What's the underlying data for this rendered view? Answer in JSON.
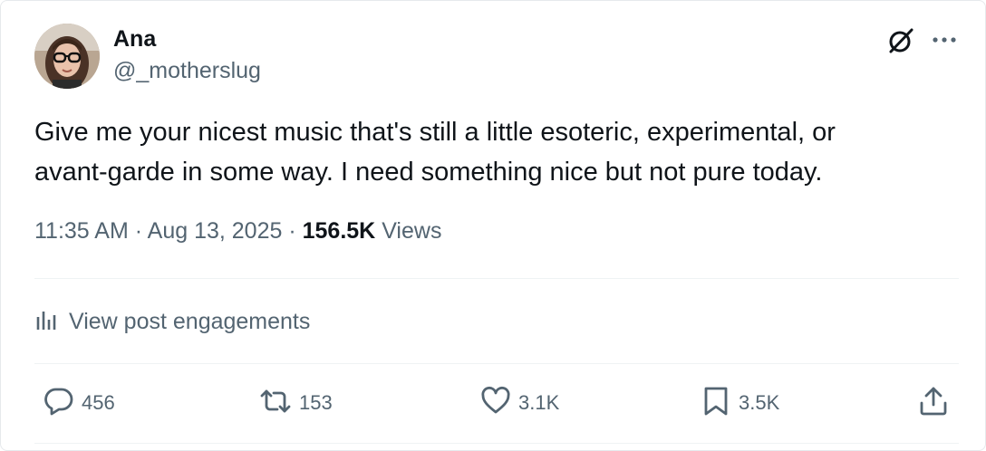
{
  "author": {
    "display_name": "Ana",
    "handle": "@_motherslug"
  },
  "icons": {
    "grok": "grok-icon",
    "more": "more-icon",
    "engagements": "analytics-icon",
    "reply": "reply-icon",
    "repost": "repost-icon",
    "like": "heart-icon",
    "bookmark": "bookmark-icon",
    "share": "share-icon"
  },
  "post": {
    "text": "Give me your nicest music that's still a little esoteric, experimental, or\navant-garde in some way. I need something nice but not pure today.",
    "time": "11:35 AM",
    "separator": "·",
    "date": "Aug 13, 2025",
    "views_count": "156.5K",
    "views_label": "Views"
  },
  "engagements_link": "View post engagements",
  "actions": {
    "replies": "456",
    "reposts": "153",
    "likes": "3.1K",
    "bookmarks": "3.5K"
  },
  "colors": {
    "text_primary": "#0f1419",
    "text_secondary": "#536471",
    "divider": "#eff3f4"
  }
}
